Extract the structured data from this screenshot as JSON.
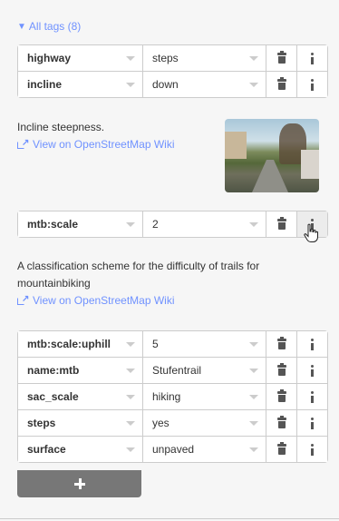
{
  "toggle": {
    "label": "All tags (8)",
    "icon": "triangle-down-icon"
  },
  "group1": {
    "rows": [
      {
        "key": "highway",
        "value": "steps"
      },
      {
        "key": "incline",
        "value": "down"
      }
    ]
  },
  "incline_info": {
    "description": "Incline steepness.",
    "link": "View on OpenStreetMap Wiki"
  },
  "group2": {
    "rows": [
      {
        "key": "mtb:scale",
        "value": "2"
      }
    ]
  },
  "mtb_info": {
    "description_line1": "A classification scheme for the difficulty of trails for",
    "description_line2": "mountainbiking",
    "link": "View on OpenStreetMap Wiki"
  },
  "group3": {
    "rows": [
      {
        "key": "mtb:scale:uphill",
        "value": "5"
      },
      {
        "key": "name:mtb",
        "value": "Stufentrail"
      },
      {
        "key": "sac_scale",
        "value": "hiking"
      },
      {
        "key": "steps",
        "value": "yes"
      },
      {
        "key": "surface",
        "value": "unpaved"
      }
    ]
  },
  "icons": {
    "remove": "trash-icon",
    "info": "info-icon",
    "add": "plus-icon",
    "link": "external-link-icon"
  },
  "colors": {
    "link": "#7092ff",
    "add_button": "#777777"
  }
}
